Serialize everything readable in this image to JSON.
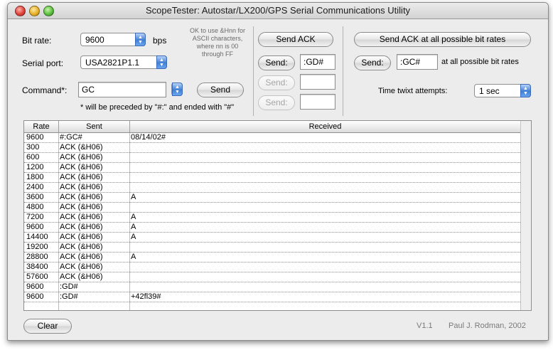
{
  "window": {
    "title": "ScopeTester: Autostar/LX200/GPS Serial Communications Utility"
  },
  "settings": {
    "bit_rate_label": "Bit rate:",
    "bit_rate_value": "9600",
    "bit_rate_unit": "bps",
    "serial_port_label": "Serial port:",
    "serial_port_value": "USA2821P1.1",
    "command_label": "Command*:",
    "command_value": "GC",
    "send_label": "Send",
    "footnote": "* will be preceded by \"#:\" and ended with \"#\"",
    "hint": "OK to use &Hnn for ASCII characters, where nn is 00 through FF"
  },
  "middle": {
    "send_ack_label": "Send ACK",
    "send1_label": "Send:",
    "send1_value": ":GD#",
    "send2_label": "Send:",
    "send2_value": "",
    "send3_label": "Send:",
    "send3_value": ""
  },
  "right": {
    "send_ack_all_label": "Send ACK at all possible bit rates",
    "send_label": "Send:",
    "send_value": ":GC#",
    "all_rates_label": "at all possible bit rates",
    "time_label": "Time twixt attempts:",
    "time_value": "1 sec"
  },
  "table": {
    "headers": [
      "Rate",
      "Sent",
      "Received"
    ],
    "rows": [
      [
        "9600",
        "#:GC#",
        "08/14/02#"
      ],
      [
        "300",
        "ACK (&H06)",
        ""
      ],
      [
        "600",
        "ACK (&H06)",
        ""
      ],
      [
        "1200",
        "ACK (&H06)",
        ""
      ],
      [
        "1800",
        "ACK (&H06)",
        ""
      ],
      [
        "2400",
        "ACK (&H06)",
        ""
      ],
      [
        "3600",
        "ACK (&H06)",
        "A"
      ],
      [
        "4800",
        "ACK (&H06)",
        ""
      ],
      [
        "7200",
        "ACK (&H06)",
        "A"
      ],
      [
        "9600",
        "ACK (&H06)",
        "A"
      ],
      [
        "14400",
        "ACK (&H06)",
        "A"
      ],
      [
        "19200",
        "ACK (&H06)",
        ""
      ],
      [
        "28800",
        "ACK (&H06)",
        "A"
      ],
      [
        "38400",
        "ACK (&H06)",
        ""
      ],
      [
        "57600",
        "ACK (&H06)",
        ""
      ],
      [
        "9600",
        ":GD#",
        ""
      ],
      [
        "9600",
        ":GD#",
        "+42fl39#"
      ]
    ]
  },
  "footer": {
    "clear_label": "Clear",
    "version": "V1.1",
    "author": "Paul J. Rodman, 2002"
  }
}
